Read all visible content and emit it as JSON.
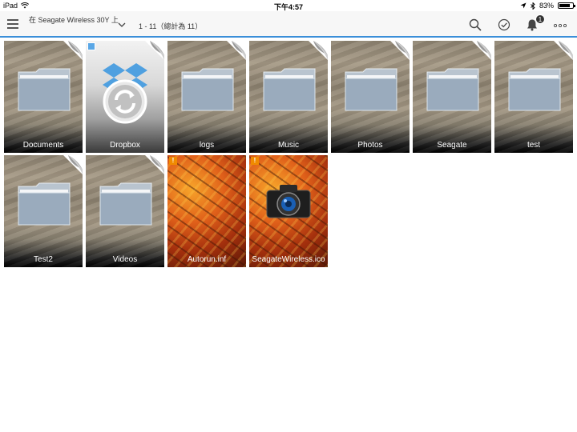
{
  "status": {
    "device": "iPad",
    "time": "下午4:57",
    "battery": "83%",
    "battery_level": 0.83
  },
  "toolbar": {
    "location": "在 Seagate Wireless 30Y 上",
    "count": "1 - 11（總計為 11）",
    "notification_count": "1"
  },
  "items": [
    {
      "name": "Documents",
      "kind": "folder"
    },
    {
      "name": "Dropbox",
      "kind": "dropbox"
    },
    {
      "name": "logs",
      "kind": "folder"
    },
    {
      "name": "Music",
      "kind": "folder"
    },
    {
      "name": "Photos",
      "kind": "folder"
    },
    {
      "name": "Seagate",
      "kind": "folder"
    },
    {
      "name": "test",
      "kind": "folder"
    },
    {
      "name": "Test2",
      "kind": "folder"
    },
    {
      "name": "Videos",
      "kind": "folder"
    },
    {
      "name": "Autorun.inf",
      "kind": "file",
      "warning": "!"
    },
    {
      "name": "SeagateWireless.ico",
      "kind": "image",
      "warning": "!"
    }
  ],
  "colors": {
    "accent": "#3b8fd9",
    "warning": "#f08a00"
  },
  "icons": [
    "menu-icon",
    "chevron-down-icon",
    "search-icon",
    "check-circle-icon",
    "bell-icon",
    "more-icon",
    "folder-icon",
    "dropbox-icon",
    "camera-icon",
    "warning-icon"
  ]
}
